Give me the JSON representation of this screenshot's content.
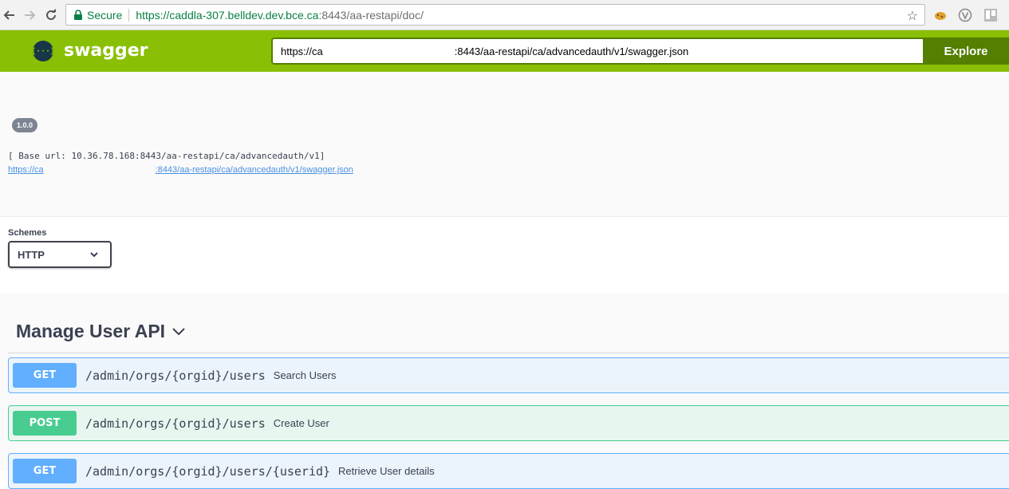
{
  "browser": {
    "secure_label": "Secure",
    "url_host": "https://caddla-307.belldev.dev.bce.ca",
    "url_path": ":8443/aa-restapi/doc/"
  },
  "topbar": {
    "logo_text": "swagger",
    "logo_glyph": "{···}",
    "spec_url_prefix": "https://ca",
    "spec_url_suffix": ":8443/aa-restapi/ca/advancedauth/v1/swagger.json",
    "explore_label": "Explore"
  },
  "info": {
    "version": "1.0.0",
    "base_url": "[ Base url: 10.36.78.168:8443/aa-restapi/ca/advancedauth/v1]",
    "spec_link_prefix": "https://ca",
    "spec_link_suffix": ":8443/aa-restapi/ca/advancedauth/v1/swagger.json"
  },
  "schemes": {
    "label": "Schemes",
    "selected": "HTTP"
  },
  "tag": {
    "title": "Manage User API"
  },
  "operations": [
    {
      "method": "GET",
      "path": "/admin/orgs/{orgid}/users",
      "summary": "Search Users"
    },
    {
      "method": "POST",
      "path": "/admin/orgs/{orgid}/users",
      "summary": "Create User"
    },
    {
      "method": "GET",
      "path": "/admin/orgs/{orgid}/users/{userid}",
      "summary": "Retrieve User details"
    }
  ],
  "colors": {
    "topbar": "#89bf04",
    "explore": "#547f00",
    "get": "#61affe",
    "post": "#49cc90"
  }
}
